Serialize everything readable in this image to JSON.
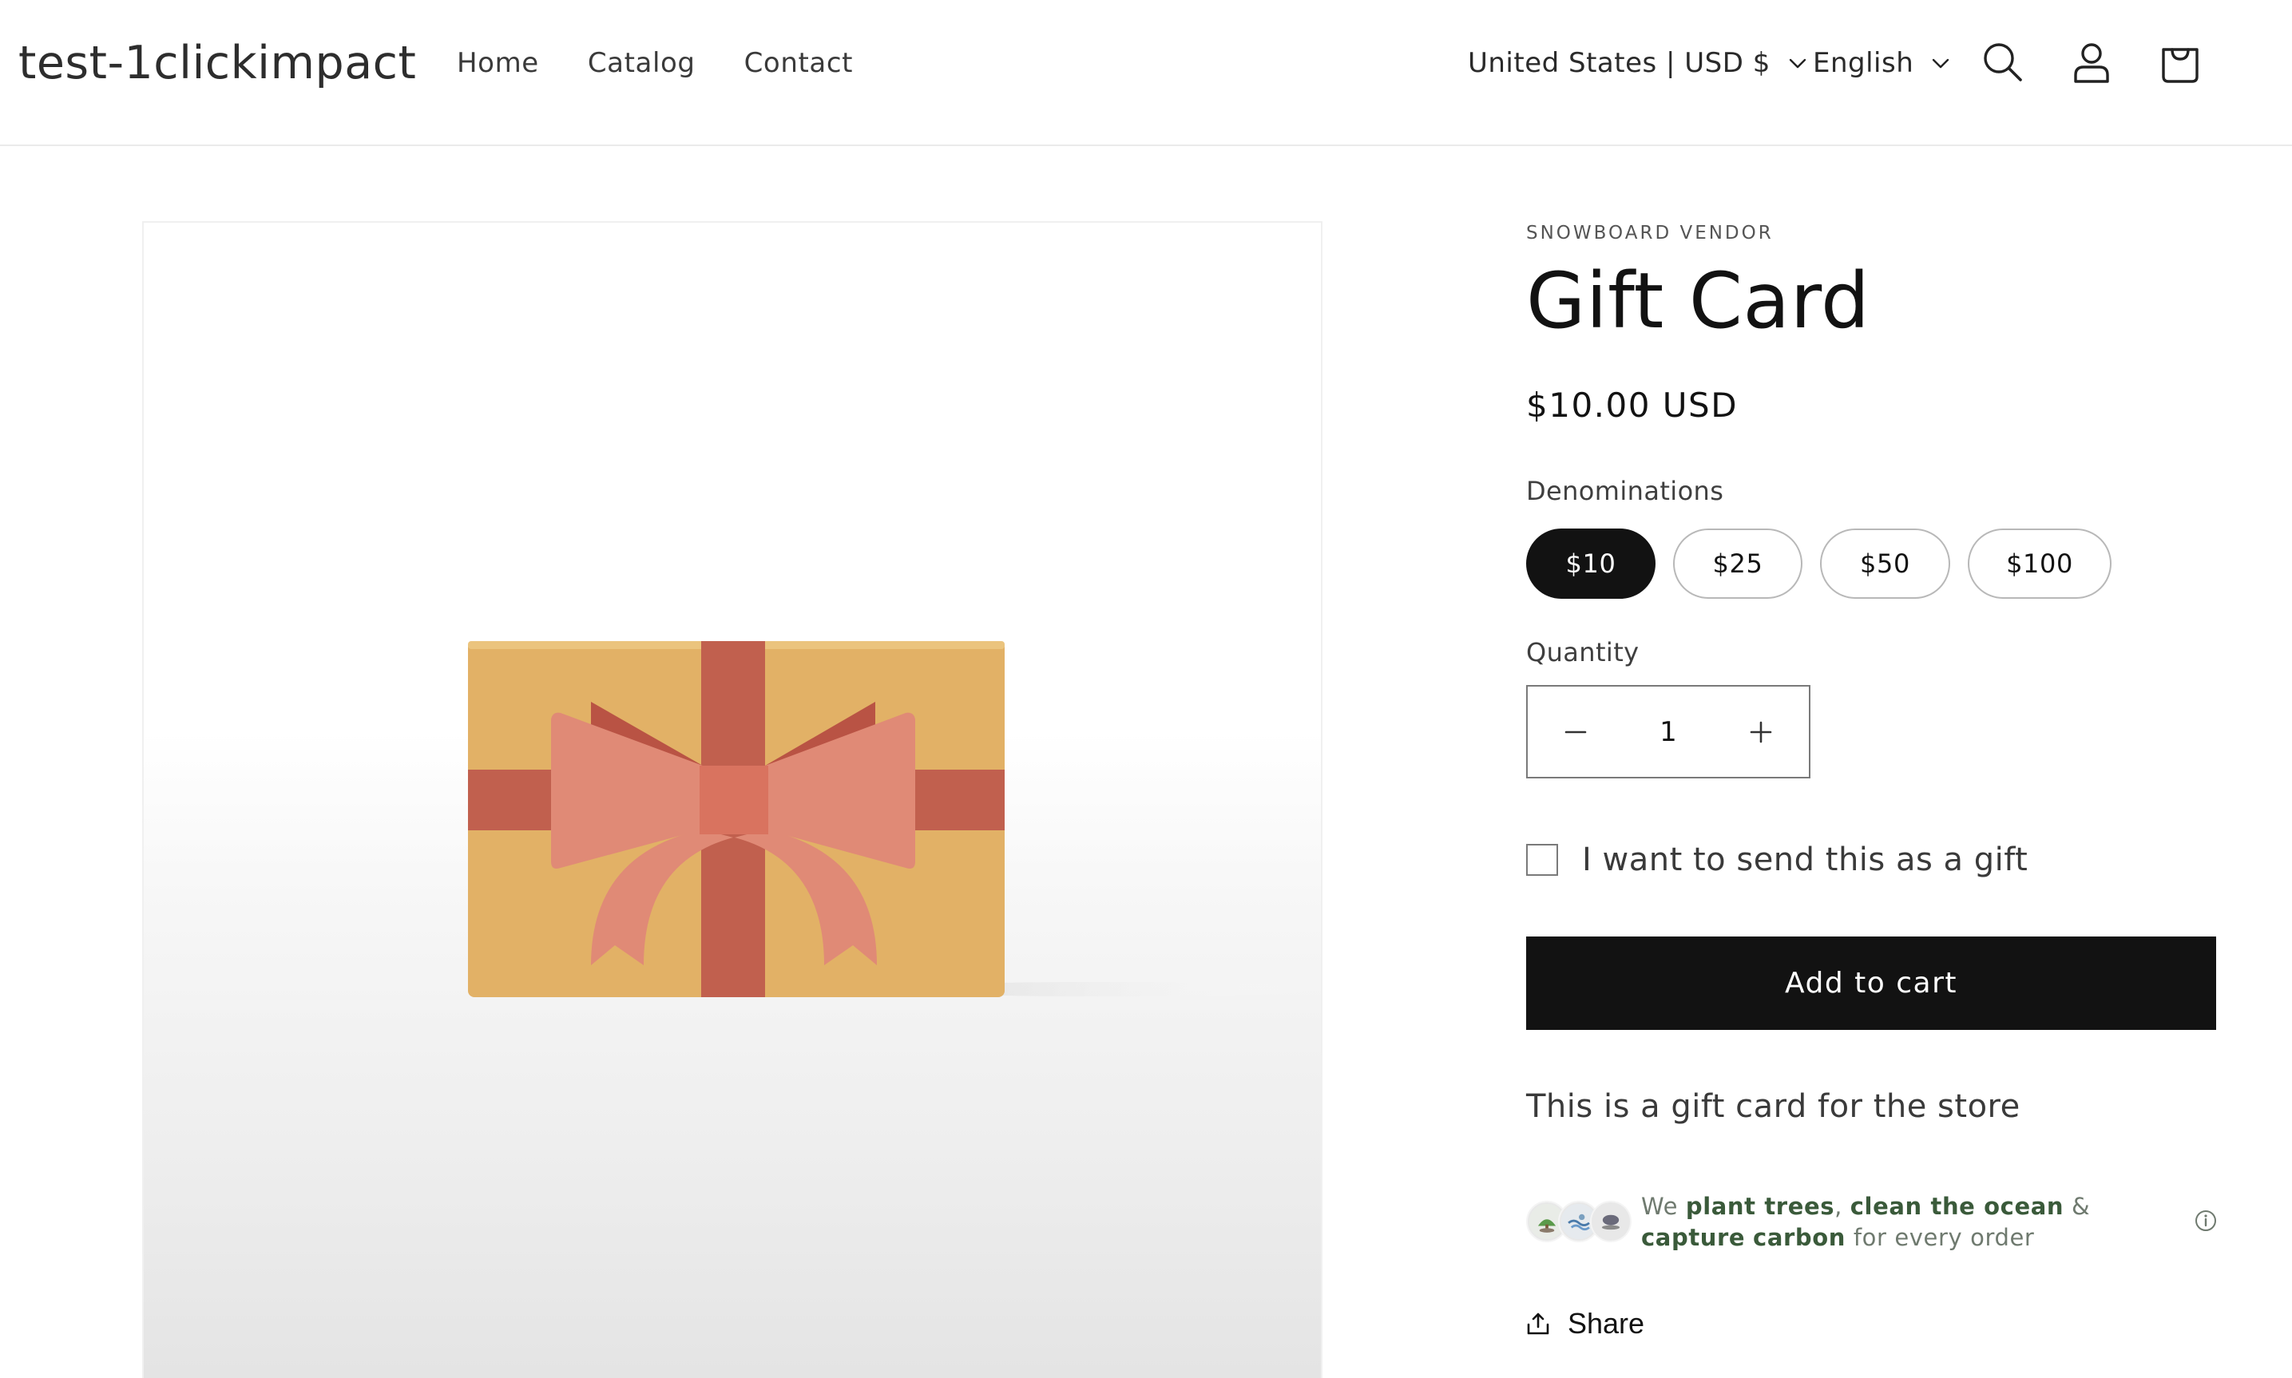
{
  "header": {
    "logo": "test-1clickimpact",
    "nav": [
      "Home",
      "Catalog",
      "Contact"
    ],
    "country_selector": "United States | USD $",
    "language_selector": "English",
    "icons": [
      "search-icon",
      "account-icon",
      "cart-icon"
    ]
  },
  "product": {
    "vendor": "SNOWBOARD VENDOR",
    "title": "Gift Card",
    "price": "$10.00 USD",
    "denominations_label": "Denominations",
    "denominations": [
      "$10",
      "$25",
      "$50",
      "$100"
    ],
    "selected_denomination": "$10",
    "quantity_label": "Quantity",
    "quantity": "1",
    "gift_checkbox_label": "I want to send this as a gift",
    "gift_checked": false,
    "add_to_cart": "Add to cart",
    "description": "This is a gift card for the store",
    "impact": {
      "we": "We",
      "plant_trees": "plant trees",
      "comma": ",",
      "clean_ocean": "clean the ocean",
      "amp": "&",
      "capture": "capture",
      "carbon": "carbon",
      "suffix": "for every order"
    },
    "share": "Share"
  },
  "colors": {
    "primary": "#121212",
    "gift_box": "#e2b166",
    "ribbon": "#c1604e",
    "bow": "#e08a76",
    "impact_green": "#3a5a3a"
  }
}
